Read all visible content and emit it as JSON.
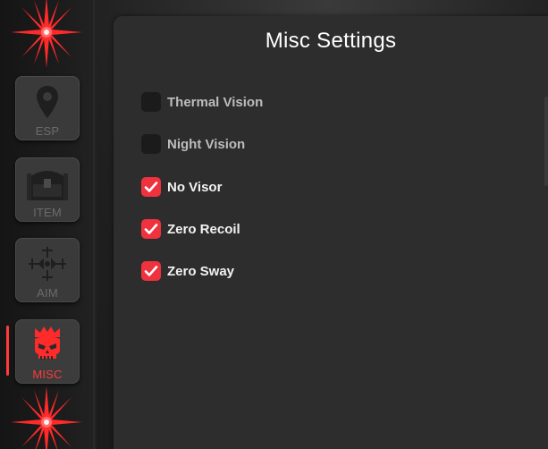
{
  "colors": {
    "accent": "#f0323f",
    "panel_bg": "#2d2d2d",
    "sidebar_bg": "#1d1d1d",
    "button_bg": "#3a3a3a",
    "inactive_label": "#6b6b6b"
  },
  "sidebar": {
    "items": [
      {
        "label": "ESP",
        "icon": "map-pin-icon",
        "active": false
      },
      {
        "label": "ITEM",
        "icon": "treasure-chest-icon",
        "active": false
      },
      {
        "label": "AIM",
        "icon": "crosshair-icon",
        "active": false
      },
      {
        "label": "MISC",
        "icon": "crowned-skull-icon",
        "active": true
      }
    ]
  },
  "panel": {
    "title": "Misc Settings",
    "options": [
      {
        "label": "Thermal Vision",
        "checked": false
      },
      {
        "label": "Night Vision",
        "checked": false
      },
      {
        "label": "No Visor",
        "checked": true
      },
      {
        "label": "Zero Recoil",
        "checked": true
      },
      {
        "label": "Zero Sway",
        "checked": true
      }
    ]
  }
}
